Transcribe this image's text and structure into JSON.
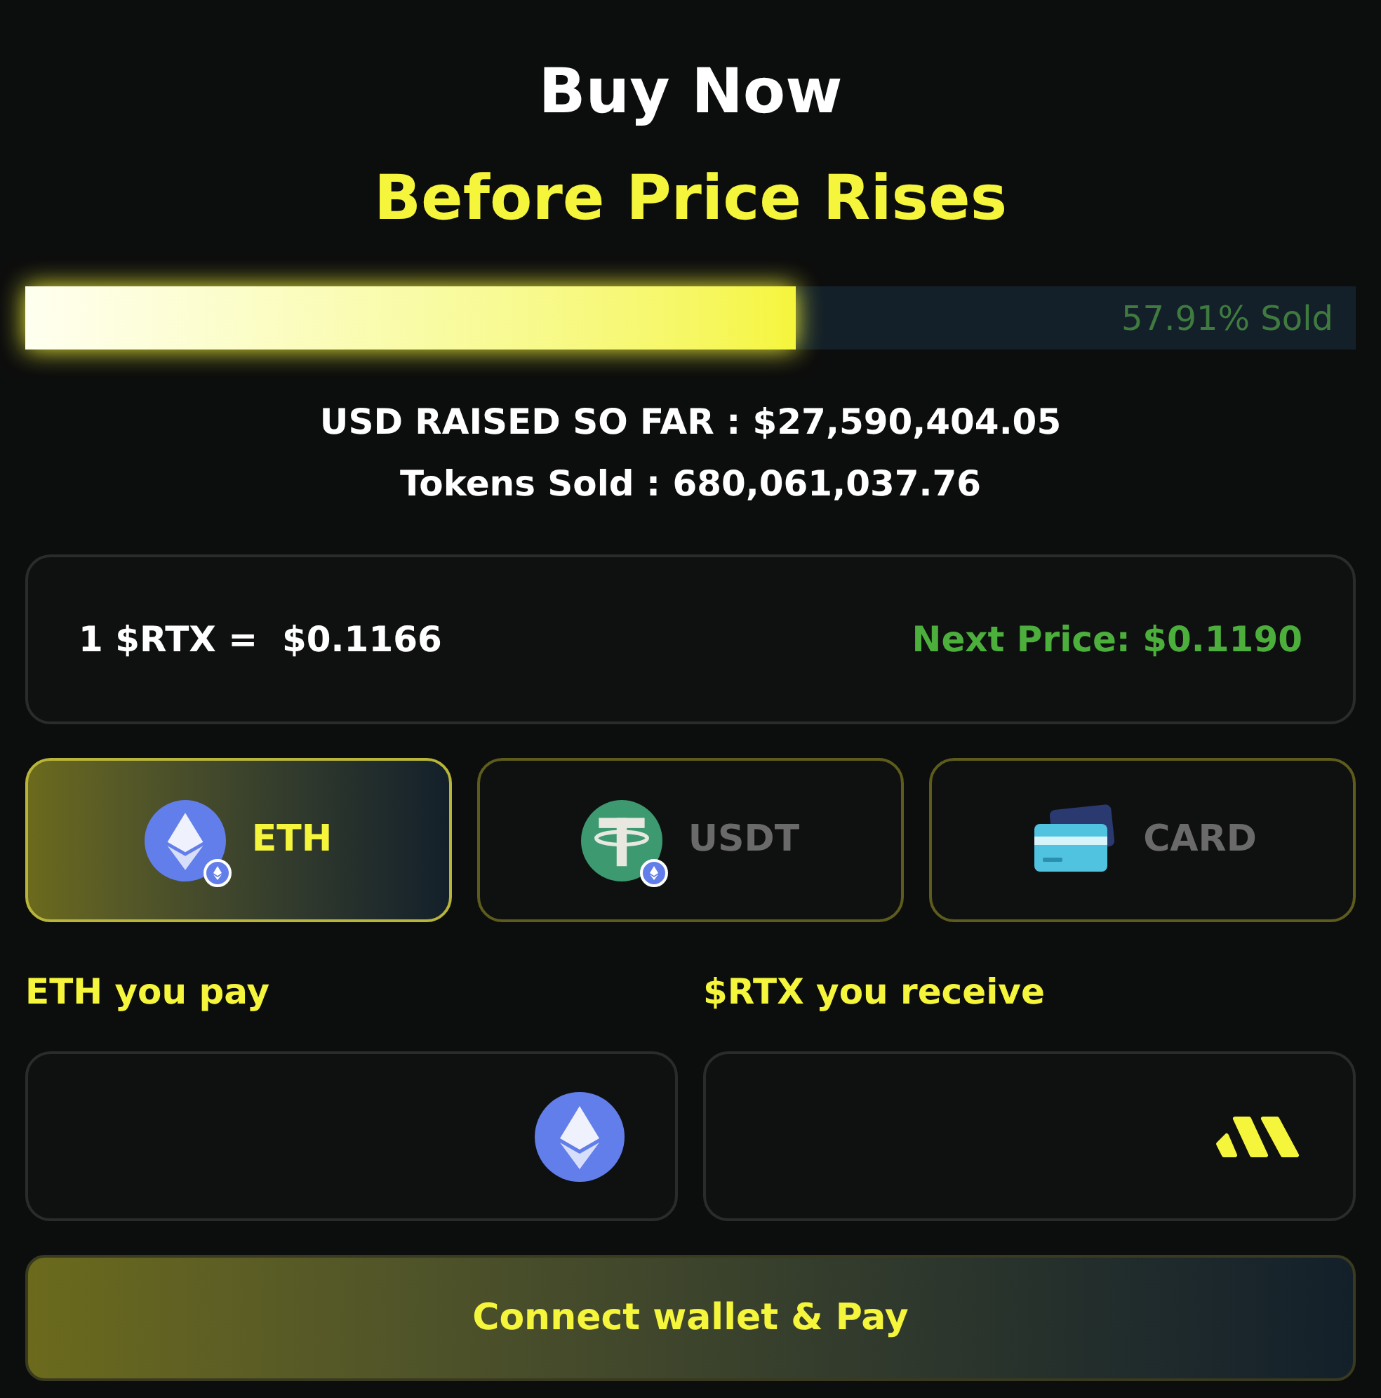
{
  "heading": {
    "title": "Buy Now",
    "subtitle": "Before Price Rises"
  },
  "progress": {
    "level": 0.5791,
    "label": "57.91% Sold"
  },
  "stats": [
    "USD RAISED SO FAR : $27,590,404.05",
    "Tokens Sold : 680,061,037.76"
  ],
  "price": {
    "current": "1 $RTX =  $0.1166",
    "next": "Next Price: $0.1190"
  },
  "methods": [
    {
      "kind": "eth",
      "label": "ETH",
      "selected": true
    },
    {
      "kind": "usdt",
      "label": "USDT",
      "selected": false
    },
    {
      "kind": "card",
      "label": "CARD",
      "selected": false
    }
  ],
  "fields": [
    {
      "kind": "eth",
      "label": "ETH you pay"
    },
    {
      "kind": "token",
      "label": "$RTX you receive"
    }
  ],
  "button": "Connect wallet & Pay"
}
